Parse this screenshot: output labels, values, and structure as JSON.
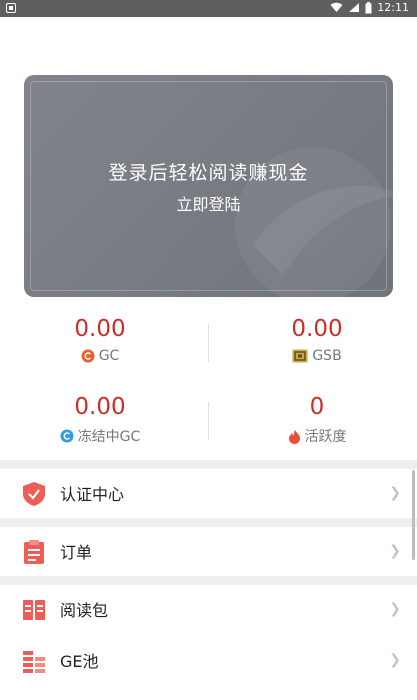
{
  "status_bar": {
    "time": "12:11"
  },
  "banner": {
    "title": "登录后轻松阅读赚现金",
    "login": "立即登陆"
  },
  "stats": [
    {
      "value": "0.00",
      "label": "GC",
      "icon": "gc-coin-icon"
    },
    {
      "value": "0.00",
      "label": "GSB",
      "icon": "gsb-coin-icon"
    },
    {
      "value": "0.00",
      "label": "冻结中GC",
      "icon": "frozen-gc-icon"
    },
    {
      "value": "0",
      "label": "活跃度",
      "icon": "flame-icon"
    }
  ],
  "menu": [
    {
      "label": "认证中心",
      "icon": "shield-check-icon"
    },
    {
      "label": "订单",
      "icon": "order-list-icon"
    },
    {
      "label": "阅读包",
      "icon": "book-icon"
    },
    {
      "label": "GE池",
      "icon": "ge-pool-icon"
    }
  ],
  "colors": {
    "accent": "#c62f2a",
    "icon_red": "#ee5e57",
    "banner": "#767981"
  }
}
